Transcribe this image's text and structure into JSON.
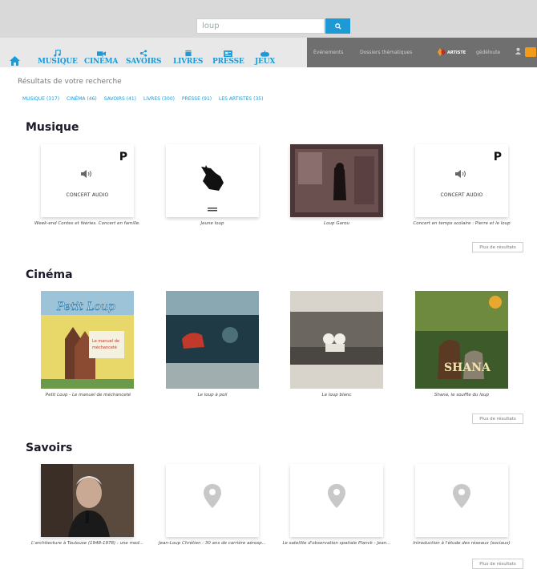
{
  "search": {
    "value": "loup",
    "button_icon": "search-icon"
  },
  "nav": {
    "home_icon": "home-icon",
    "items": [
      {
        "label": "MUSIQUE",
        "icon": "music-icon"
      },
      {
        "label": "CINÉMA",
        "icon": "camera-icon"
      },
      {
        "label": "SAVOIRS",
        "icon": "share-icon"
      },
      {
        "label": "LIVRES",
        "icon": "book-icon"
      },
      {
        "label": "PRESSE",
        "icon": "newspaper-icon"
      },
      {
        "label": "JEUX",
        "icon": "gamepad-icon"
      }
    ],
    "right_links": [
      "Événements",
      "Dossiers thématiques"
    ],
    "logo_text": "ARTISTE",
    "user_label": "gédéloute",
    "accent_color": "#1d9ad6"
  },
  "results": {
    "title": "Résultats de votre recherche",
    "filters": [
      "MUSIQUE (317)",
      "CINÉMA (46)",
      "SAVOIRS (41)",
      "LIVRES (300)",
      "PRESSE (91)",
      "LES ARTISTES (35)"
    ]
  },
  "sections": [
    {
      "title": "Musique",
      "more_label": "Plus de résultats",
      "cards": [
        {
          "type": "concert",
          "caption": "CONCERT AUDIO",
          "label": "Week-end Contes et fééries. Concert en famille."
        },
        {
          "type": "image",
          "label": "Jeune loup"
        },
        {
          "type": "image",
          "label": "Loup Garou"
        },
        {
          "type": "concert",
          "caption": "CONCERT AUDIO",
          "label": "Concert en temps scolaire : Pierre et le loup"
        }
      ]
    },
    {
      "title": "Cinéma",
      "more_label": "Plus de résultats",
      "cards": [
        {
          "type": "poster",
          "poster_title": "Petit Loup",
          "poster_sub": "Le manuel de méchanceté",
          "label": "Petit Loup - Le manuel de méchanceté"
        },
        {
          "type": "poster",
          "label": "Le loup à poil"
        },
        {
          "type": "poster",
          "label": "Le loup blanc"
        },
        {
          "type": "poster",
          "poster_title": "SHANA",
          "label": "Shana, le souffle du loup"
        }
      ]
    },
    {
      "title": "Savoirs",
      "more_label": "Plus de résultats",
      "cards": [
        {
          "type": "photo",
          "label": "L'architecture à Toulouse (1948-1978) : une mod..."
        },
        {
          "type": "placeholder",
          "label": "Jean-Loup Chrétien : 30 ans de carrière aérosp..."
        },
        {
          "type": "placeholder",
          "label": "Le satellite d'observation spatiale Planck - Jean..."
        },
        {
          "type": "placeholder",
          "label": "Introduction à l'étude des réseaux (sociaux)"
        }
      ]
    }
  ]
}
